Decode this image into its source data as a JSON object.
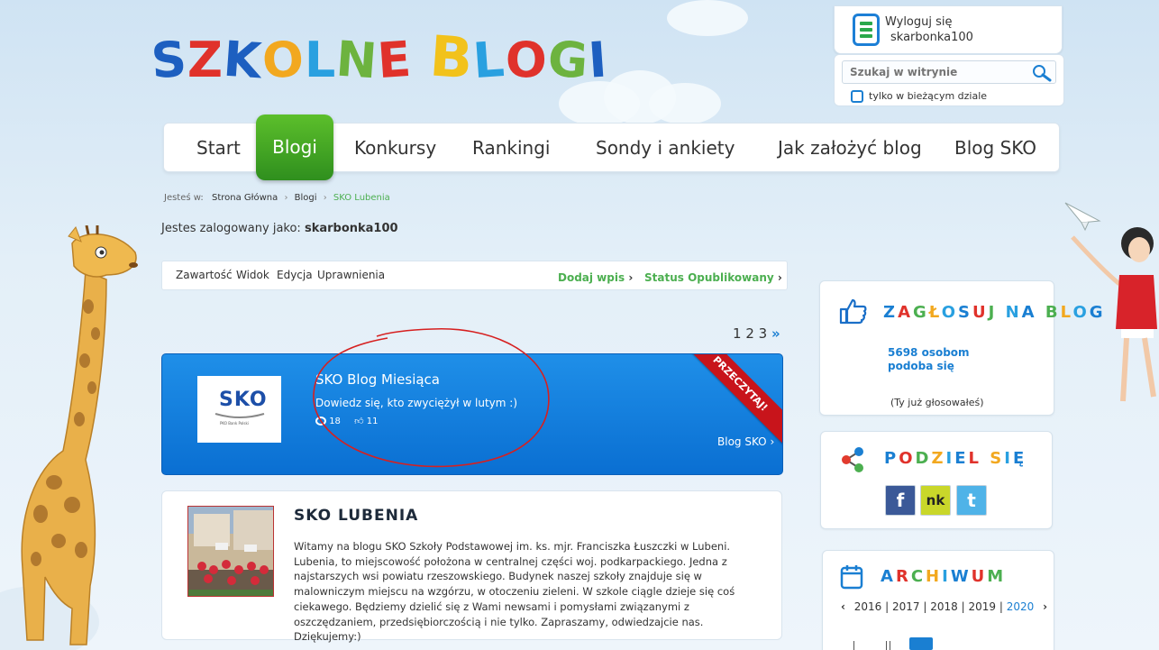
{
  "logo": {
    "letters": [
      "S",
      "Z",
      "K",
      "O",
      "L",
      "N",
      "E",
      " ",
      "B",
      "L",
      "O",
      "G",
      "I"
    ],
    "colors": [
      "#1d5fc0",
      "#e0322b",
      "#1d5fc0",
      "#f2a81f",
      "#29a0e0",
      "#6db33f",
      "#e0322b",
      "#ffffff",
      "#f2c21b",
      "#29a0e0",
      "#e0322b",
      "#6db33f",
      "#1d5fc0"
    ]
  },
  "user": {
    "logout_label": "Wyloguj się",
    "username": "skarbonka100"
  },
  "search": {
    "placeholder": "Szukaj w witrynie",
    "checkbox_label": "tylko w bieżącym dziale"
  },
  "nav": {
    "start": "Start",
    "blogi": "Blogi",
    "konkursy": "Konkursy",
    "rankingi": "Rankingi",
    "sondy": "Sondy i ankiety",
    "jak": "Jak założyć blog",
    "blogsko": "Blog SKO"
  },
  "breadcrumb": {
    "prefix": "Jesteś w:",
    "home": "Strona Główna",
    "blogi": "Blogi",
    "current": "SKO Lubenia"
  },
  "logged_in": {
    "prefix": "Jestes zalogowany jako:",
    "user": "skarbonka100"
  },
  "toolbar": {
    "zawartosc": "Zawartość",
    "widok": "Widok",
    "edycja": "Edycja",
    "uprawnienia": "Uprawnienia",
    "dodaj": "Dodaj wpis",
    "status": "Status Opublikowany"
  },
  "pagination": {
    "p1": "1",
    "p2": "2",
    "p3": "3",
    "next": "»"
  },
  "featured": {
    "logo_text": "SKO",
    "logo_sub": "PKO Bank Polski",
    "title": "SKO Blog Miesiąca",
    "description": "Dowiedz się, kto zwyciężył w lutym :)",
    "comments": "18",
    "likes": "11",
    "link": "Blog SKO",
    "ribbon": "PRZECZYTAJ!"
  },
  "blog": {
    "title": "SKO LUBENIA",
    "text": "Witamy na blogu SKO Szkoły Podstawowej im. ks. mjr. Franciszka Łuszczki w Lubeni. Lubenia, to miejscowość położona w centralnej części woj. podkarpackiego. Jedna z najstarszych wsi powiatu rzeszowskiego. Budynek naszej szkoły znajduje się w malowniczym miejscu na wzgórzu, w otoczeniu zieleni. W szkole ciągle dzieje się coś ciekawego. Będziemy dzielić się z Wami newsami i pomysłami związanymi z oszczędzaniem, przedsiębiorczością i nie tylko. Zapraszamy, odwiedzajcie nas. Dziękujemy:)"
  },
  "vote": {
    "title": "ZAGŁOSUJ NA BLOG",
    "count_line1": "5698 osobom",
    "count_line2": "podoba się",
    "voted": "(Ty już głosowałeś)"
  },
  "share": {
    "title": "PODZIEL SIĘ",
    "fb": "f",
    "nk": "nk",
    "tw": "t"
  },
  "archive": {
    "title": "ARCHIWUM",
    "prev": "‹",
    "next": "›",
    "y2016": "2016",
    "y2017": "2017",
    "y2018": "2018",
    "y2019": "2019",
    "y2020": "2020",
    "sep": "|"
  }
}
